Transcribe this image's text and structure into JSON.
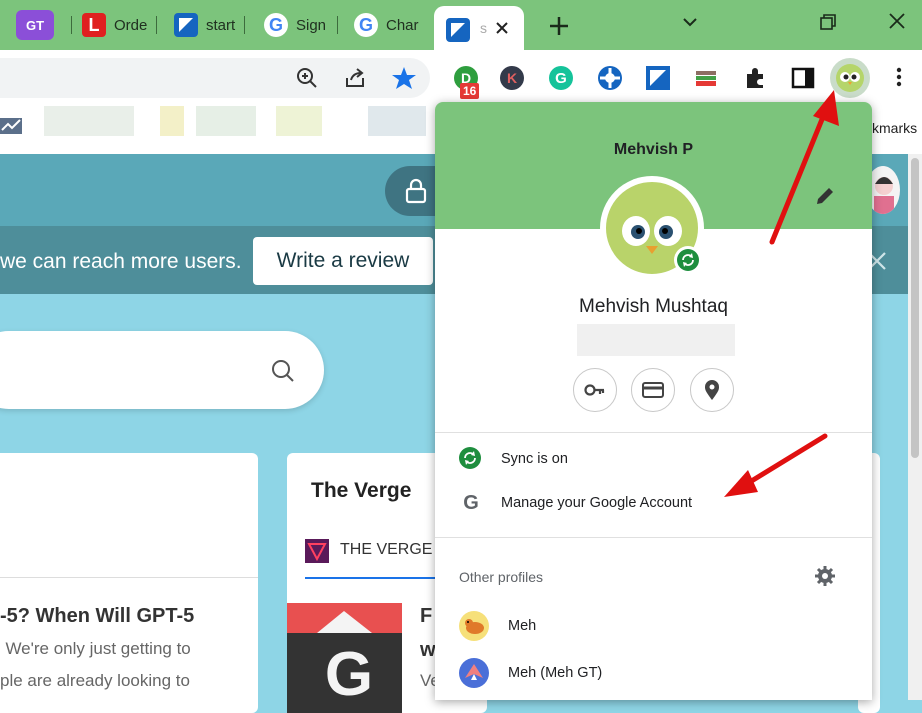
{
  "tabs": [
    {
      "favicon": "GT",
      "label": ""
    },
    {
      "favicon": "L",
      "label": "Orde"
    },
    {
      "favicon": "start-icon",
      "label": "start"
    },
    {
      "favicon": "G",
      "label": "Sign"
    },
    {
      "favicon": "G",
      "label": "Char"
    },
    {
      "favicon": "start-icon",
      "label": "s"
    }
  ],
  "toolbar": {
    "extension_badge": "16",
    "extension_k": "K"
  },
  "bookmarks": {
    "partial_label": "kmarks"
  },
  "page": {
    "banner_text": "we can reach more users.",
    "write_review": "Write a review",
    "card_title": "The Verge",
    "source_label": "THE VERGE",
    "headline": "-5? When Will GPT-5",
    "snippet_1": ". We're only just getting to",
    "snippet_2": "ple are already looking to",
    "partial_f": "F",
    "partial_w": "w",
    "partial_ve": "Ve"
  },
  "profile": {
    "header_name": "Mehvish P",
    "full_name": "Mehvish Mushtaq",
    "sync_label": "Sync is on",
    "manage_label": "Manage your Google Account",
    "other_profiles_label": "Other profiles",
    "other_profiles": [
      {
        "name": "Meh"
      },
      {
        "name": "Meh (Meh GT)"
      }
    ]
  },
  "colors": {
    "chrome_green": "#7cc47c",
    "accent_blue": "#1a73e8",
    "arrow_red": "#e01010",
    "sync_green": "#1e8e3e"
  }
}
